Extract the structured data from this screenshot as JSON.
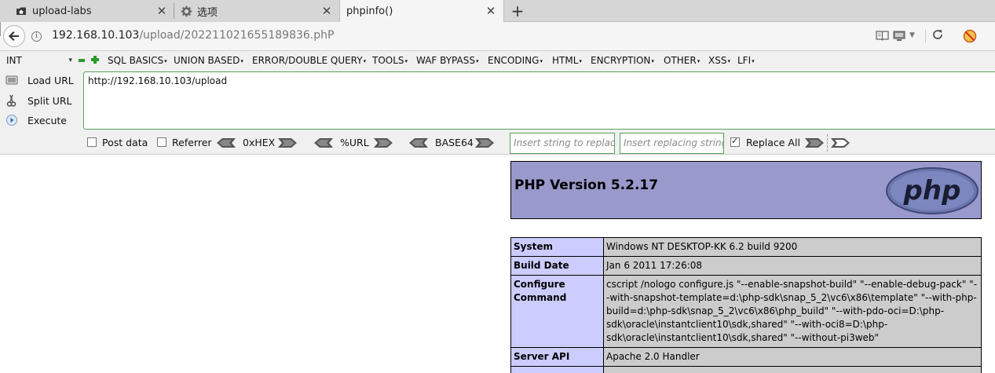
{
  "tabs": [
    {
      "label": "upload-labs",
      "icon": "folder-home-icon"
    },
    {
      "label": "选项",
      "icon": "gear-icon"
    },
    {
      "label": "phpinfo()",
      "icon": "none"
    }
  ],
  "nav": {
    "url_host": "192.168.10.103",
    "url_path": "/upload/202211021655189836.phP"
  },
  "hackbar": {
    "select_value": "INT",
    "menus": [
      "SQL BASICS",
      "UNION BASED",
      "ERROR/DOUBLE QUERY",
      "TOOLS",
      "WAF BYPASS",
      "ENCODING",
      "HTML",
      "ENCRYPTION",
      "OTHER",
      "XSS",
      "LFI"
    ],
    "actions": {
      "load_url": "Load URL",
      "split_url": "Split URL",
      "execute": "Execute"
    },
    "url_value": "http://192.168.10.103/upload",
    "options": {
      "post_data": "Post data",
      "referrer": "Referrer",
      "hex": "0xHEX",
      "url_enc": "%URL",
      "base64": "BASE64",
      "replace_placeholder": "Insert string to replace",
      "replacing_placeholder": "Insert replacing string",
      "replace_all": "Replace All"
    },
    "replace_all_checked": true
  },
  "phpinfo": {
    "title": "PHP Version 5.2.17",
    "logo_text": "php",
    "rows": [
      {
        "key": "System",
        "value": "Windows NT DESKTOP-KK 6.2 build 9200"
      },
      {
        "key": "Build Date",
        "value": "Jan 6 2011 17:26:08"
      },
      {
        "key": "Configure Command",
        "value": "cscript /nologo configure.js \"--enable-snapshot-build\" \"--enable-debug-pack\" \"--with-snapshot-template=d:\\php-sdk\\snap_5_2\\vc6\\x86\\template\" \"--with-php-build=d:\\php-sdk\\snap_5_2\\vc6\\x86\\php_build\" \"--with-pdo-oci=D:\\php-sdk\\oracle\\instantclient10\\sdk,shared\" \"--with-oci8=D:\\php-sdk\\oracle\\instantclient10\\sdk,shared\" \"--without-pi3web\""
      },
      {
        "key": "Server API",
        "value": "Apache 2.0 Handler"
      }
    ]
  },
  "colors": {
    "php_header_bg": "#9999cc",
    "php_key_bg": "#ccccff",
    "php_value_bg": "#cccccc",
    "hackbar_green": "#58a05a"
  }
}
